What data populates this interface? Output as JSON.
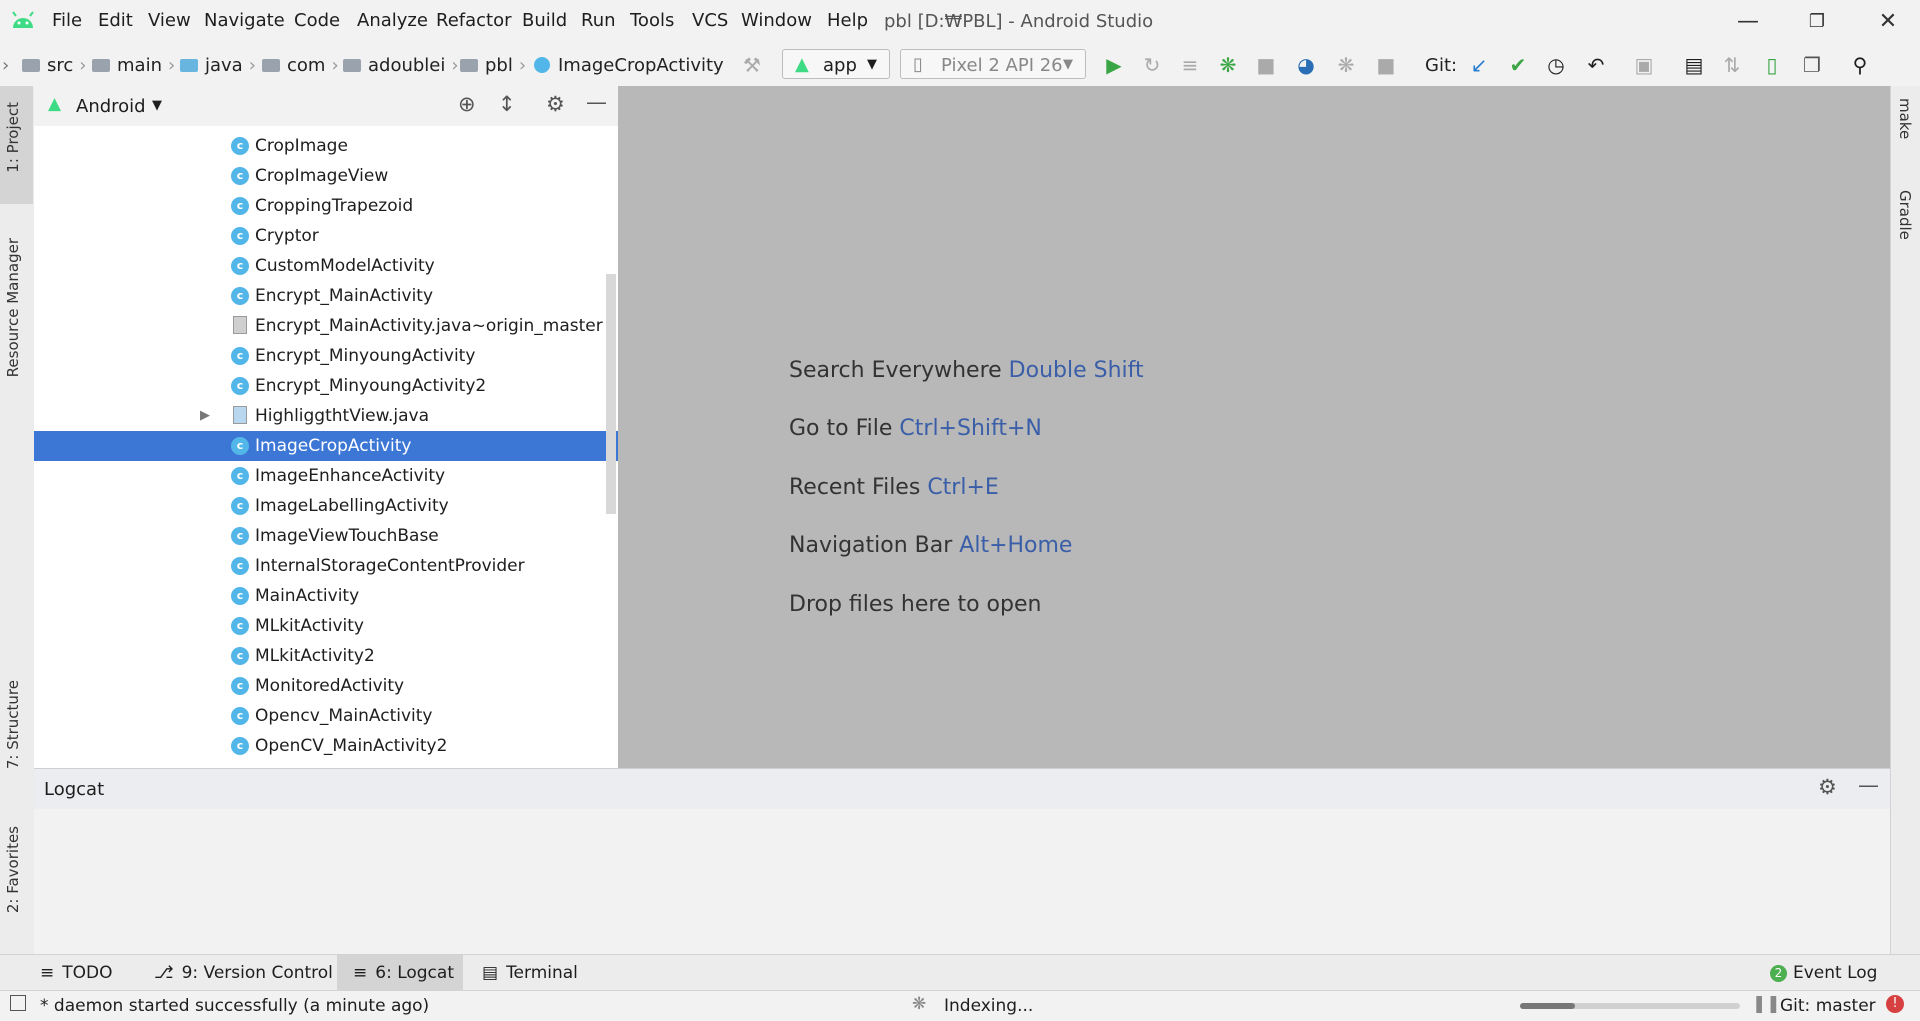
{
  "window": {
    "title": "pbl [D:₩PBL] - Android Studio",
    "menu": [
      "File",
      "Edit",
      "View",
      "Navigate",
      "Code",
      "Analyze",
      "Refactor",
      "Build",
      "Run",
      "Tools",
      "VCS",
      "Window",
      "Help"
    ]
  },
  "breadcrumb": [
    "src",
    "main",
    "java",
    "com",
    "adoublei",
    "pbl",
    "ImageCropActivity"
  ],
  "toolbar": {
    "run_config": "app",
    "device": "Pixel 2 API 26",
    "git_label": "Git:"
  },
  "left_tabs": [
    "1: Project",
    "Resource Manager",
    "7: Structure",
    "2: Favorites"
  ],
  "right_tabs": [
    "make",
    "Gradle"
  ],
  "project_panel": {
    "view_mode": "Android",
    "items": [
      {
        "label": "CropImage",
        "kind": "class",
        "selected": false
      },
      {
        "label": "CropImageView",
        "kind": "class",
        "selected": false
      },
      {
        "label": "CroppingTrapezoid",
        "kind": "class",
        "selected": false
      },
      {
        "label": "Cryptor",
        "kind": "class",
        "selected": false
      },
      {
        "label": "CustomModelActivity",
        "kind": "class",
        "selected": false
      },
      {
        "label": "Encrypt_MainActivity",
        "kind": "class",
        "selected": false
      },
      {
        "label": "Encrypt_MainActivity.java~origin_master",
        "kind": "file",
        "selected": false
      },
      {
        "label": "Encrypt_MinyoungActivity",
        "kind": "class",
        "selected": false
      },
      {
        "label": "Encrypt_MinyoungActivity2",
        "kind": "class",
        "selected": false
      },
      {
        "label": "HighliggthtView.java",
        "kind": "java",
        "selected": false
      },
      {
        "label": "ImageCropActivity",
        "kind": "class",
        "selected": true
      },
      {
        "label": "ImageEnhanceActivity",
        "kind": "class",
        "selected": false
      },
      {
        "label": "ImageLabellingActivity",
        "kind": "class",
        "selected": false
      },
      {
        "label": "ImageViewTouchBase",
        "kind": "class",
        "selected": false
      },
      {
        "label": "InternalStorageContentProvider",
        "kind": "class",
        "selected": false
      },
      {
        "label": "MainActivity",
        "kind": "class",
        "selected": false
      },
      {
        "label": "MLkitActivity",
        "kind": "class",
        "selected": false
      },
      {
        "label": "MLkitActivity2",
        "kind": "class",
        "selected": false
      },
      {
        "label": "MonitoredActivity",
        "kind": "class",
        "selected": false
      },
      {
        "label": "Opencv_MainActivity",
        "kind": "class",
        "selected": false
      },
      {
        "label": "OpenCV_MainActivity2",
        "kind": "class",
        "selected": false
      }
    ]
  },
  "editor_hints": [
    {
      "text": "Search Everywhere",
      "key": "Double Shift"
    },
    {
      "text": "Go to File",
      "key": "Ctrl+Shift+N"
    },
    {
      "text": "Recent Files",
      "key": "Ctrl+E"
    },
    {
      "text": "Navigation Bar",
      "key": "Alt+Home"
    },
    {
      "text": "Drop files here to open",
      "key": ""
    }
  ],
  "logcat": {
    "title": "Logcat"
  },
  "bottom_tabs": [
    "TODO",
    "9: Version Control",
    "6: Logcat",
    "Terminal"
  ],
  "event_log": {
    "label": "Event Log",
    "count": "2"
  },
  "status": {
    "message": "* daemon started successfully (a minute ago)",
    "indexing": "Indexing...",
    "git_branch": "Git: master"
  },
  "colors": {
    "selection": "#3d77d6",
    "key_hint": "#3a5ea8",
    "android_green": "#3ddc84"
  }
}
